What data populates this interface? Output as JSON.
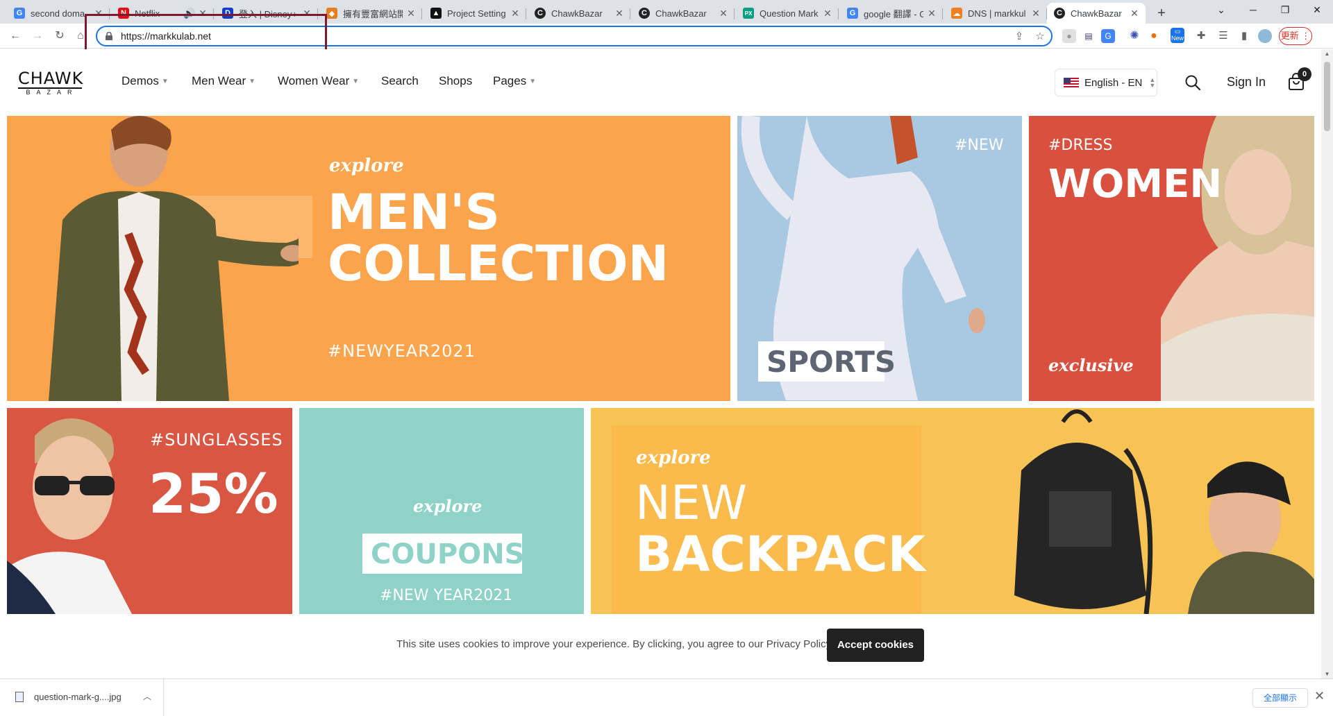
{
  "browser": {
    "tabs": [
      {
        "label": "second doma",
        "favicon_text": "G",
        "favicon_color": "#4285f4",
        "audio": false,
        "active": false
      },
      {
        "label": "Netflix",
        "favicon_text": "N",
        "favicon_color": "#e50914",
        "audio": true,
        "active": false
      },
      {
        "label": "登入 | Disney+",
        "favicon_text": "D",
        "favicon_color": "#113ccf",
        "audio": false,
        "active": false
      },
      {
        "label": "擁有豐富網站開",
        "favicon_text": "◆",
        "favicon_color": "#e67e22",
        "audio": false,
        "active": false
      },
      {
        "label": "Project Setting",
        "favicon_text": "▲",
        "favicon_color": "#111111",
        "audio": false,
        "active": false
      },
      {
        "label": "ChawkBazar",
        "favicon_text": "C",
        "favicon_color": "#222222",
        "audio": false,
        "active": false
      },
      {
        "label": "ChawkBazar",
        "favicon_text": "C",
        "favicon_color": "#222222",
        "audio": false,
        "active": false
      },
      {
        "label": "Question Mark",
        "favicon_text": "PX",
        "favicon_color": "#05a081",
        "audio": false,
        "active": false
      },
      {
        "label": "google 翻譯 - G",
        "favicon_text": "G",
        "favicon_color": "#4285f4",
        "audio": false,
        "active": false
      },
      {
        "label": "DNS | markkul",
        "favicon_text": "☁",
        "favicon_color": "#f38020",
        "audio": false,
        "active": false
      },
      {
        "label": "ChawkBazar",
        "favicon_text": "C",
        "favicon_color": "#222222",
        "audio": false,
        "active": true
      }
    ],
    "tab_close_glyph": "✕",
    "new_tab_glyph": "+",
    "url": "https://markkulab.net",
    "update_label": "更新",
    "extension_new_badge": "New"
  },
  "site": {
    "logo_top": "CHAWK",
    "logo_bottom": "BAZAR",
    "nav": [
      {
        "label": "Demos",
        "has_dropdown": true
      },
      {
        "label": "Men Wear",
        "has_dropdown": true
      },
      {
        "label": "Women Wear",
        "has_dropdown": true
      },
      {
        "label": "Search",
        "has_dropdown": false
      },
      {
        "label": "Shops",
        "has_dropdown": false
      },
      {
        "label": "Pages",
        "has_dropdown": true
      }
    ],
    "language": "English - EN",
    "sign_in": "Sign In",
    "cart_count": "0"
  },
  "banners": {
    "mens": {
      "script": "explore",
      "line1": "MEN'S",
      "line2": "COLLECTION",
      "tag": "#NEWYEAR2021",
      "bg": "#fba44c"
    },
    "sports": {
      "tag": "#NEW",
      "label": "SPORTS",
      "bg": "#a9c8e2"
    },
    "women": {
      "tag": "#DRESS",
      "title": "WOMEN",
      "script": "exclusive",
      "bg": "#d9513e"
    },
    "sunglasses": {
      "tag": "#SUNGLASSES",
      "title": "25%",
      "bg": "#d95642"
    },
    "coupons": {
      "script": "explore",
      "label": "COUPONS",
      "tag": "#NEW YEAR2021",
      "bg": "#8fd2c8"
    },
    "backpack": {
      "script": "explore",
      "line1": "NEW",
      "line2": "BACKPACK",
      "bg": "#f7c354"
    }
  },
  "cookie": {
    "text": "This site uses cookies to improve your experience. By clicking, you agree to our Privacy Policy.",
    "button": "Accept cookies"
  },
  "downloads": {
    "filename": "question-mark-g....jpg",
    "show_all": "全部顯示"
  }
}
